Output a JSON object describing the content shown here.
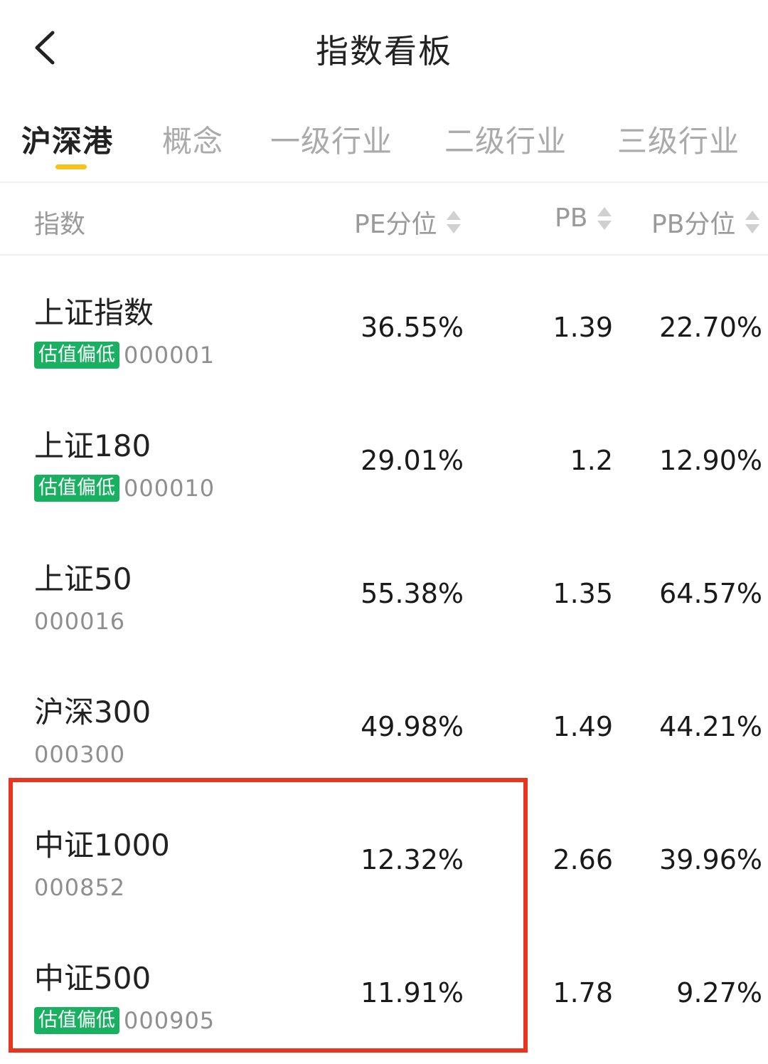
{
  "header": {
    "title": "指数看板"
  },
  "tabs": [
    {
      "label": "沪深港",
      "active": true
    },
    {
      "label": "概念",
      "active": false
    },
    {
      "label": "一级行业",
      "active": false
    },
    {
      "label": "二级行业",
      "active": false
    },
    {
      "label": "三级行业",
      "active": false
    }
  ],
  "columns": {
    "index": "指数",
    "pe_pct": "PE分位",
    "pb": "PB",
    "pb_pct": "PB分位"
  },
  "rows": [
    {
      "name": "上证指数",
      "badge": "估值偏低",
      "code": "000001",
      "pe_pct": "36.55%",
      "pb": "1.39",
      "pb_pct": "22.70%"
    },
    {
      "name": "上证180",
      "badge": "估值偏低",
      "code": "000010",
      "pe_pct": "29.01%",
      "pb": "1.2",
      "pb_pct": "12.90%"
    },
    {
      "name": "上证50",
      "badge": "",
      "code": "000016",
      "pe_pct": "55.38%",
      "pb": "1.35",
      "pb_pct": "64.57%"
    },
    {
      "name": "沪深300",
      "badge": "",
      "code": "000300",
      "pe_pct": "49.98%",
      "pb": "1.49",
      "pb_pct": "44.21%"
    },
    {
      "name": "中证1000",
      "badge": "",
      "code": "000852",
      "pe_pct": "12.32%",
      "pb": "2.66",
      "pb_pct": "39.96%"
    },
    {
      "name": "中证500",
      "badge": "估值偏低",
      "code": "000905",
      "pe_pct": "11.91%",
      "pb": "1.78",
      "pb_pct": "9.27%"
    }
  ],
  "colors": {
    "accent": "#f7c21c",
    "badge": "#19b061",
    "highlight": "#e8351f"
  }
}
